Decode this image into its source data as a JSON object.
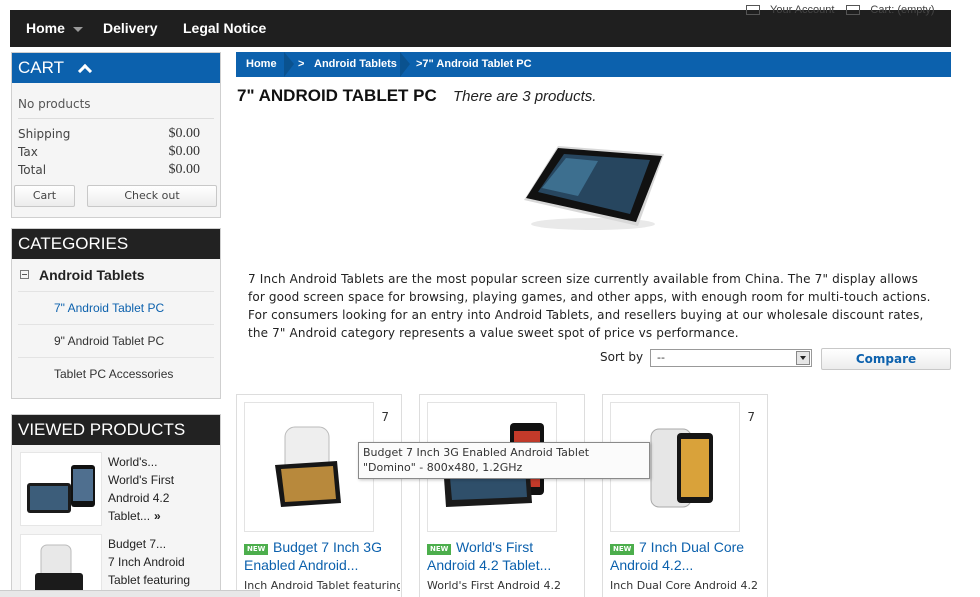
{
  "colors": {
    "accent": "#0c61ad",
    "dark": "#222222",
    "new_badge": "#4cae4c"
  },
  "topnav": {
    "items": [
      {
        "label": "Home",
        "has_dropdown": true
      },
      {
        "label": "Delivery"
      },
      {
        "label": "Legal Notice"
      }
    ],
    "account_label": "Your Account",
    "cart_label": "Cart: (empty)"
  },
  "cart": {
    "title": "CART",
    "empty_text": "No products",
    "rows": [
      {
        "label": "Shipping",
        "value": "$0.00"
      },
      {
        "label": "Tax",
        "value": "$0.00"
      },
      {
        "label": "Total",
        "value": "$0.00"
      }
    ],
    "cart_button": "Cart",
    "checkout_button": "Check out"
  },
  "categories": {
    "title": "CATEGORIES",
    "parent": "Android Tablets",
    "children": [
      {
        "label": "7\" Android Tablet PC",
        "active": true
      },
      {
        "label": "9\" Android Tablet PC"
      },
      {
        "label": "Tablet PC Accessories"
      }
    ]
  },
  "viewed": {
    "title": "VIEWED PRODUCTS",
    "items": [
      {
        "title": "World's...",
        "text": "World's First Android 4.2 Tablet...",
        "more": "»"
      },
      {
        "title": "Budget 7...",
        "text": "7 Inch Android Tablet featuring"
      }
    ]
  },
  "breadcrumb": {
    "home": "Home",
    "sep1": ">",
    "level1": "Android Tablets",
    "level2": ">7\" Android Tablet PC"
  },
  "category_heading": "7\" ANDROID TABLET PC",
  "product_count": "There are 3 products.",
  "description": "7 Inch Android Tablets are the most popular screen size currently available from China. The 7\" display allows for good screen space for browsing, playing games, and other apps, with enough room for multi-touch actions. For consumers looking for an entry into Android Tablets, and resellers buying at our wholesale discount rates, the 7\" Android category represents a value sweet spot of price vs performance.",
  "sort": {
    "label": "Sort by",
    "selected": "--"
  },
  "compare_button": "Compare",
  "products": [
    {
      "badge": "NEW",
      "corner": "7",
      "title": "Budget 7 Inch 3G Enabled Android...",
      "subtitle": "Inch Android Tablet featuring"
    },
    {
      "badge": "NEW",
      "corner": "",
      "title": "World's First Android 4.2 Tablet...",
      "subtitle": "World's First Android 4.2"
    },
    {
      "badge": "NEW",
      "corner": "7",
      "title": "7 Inch Dual Core Android 4.2...",
      "subtitle": "Inch Dual Core Android 4.2"
    }
  ],
  "tooltip": "Budget 7 Inch 3G Enabled Android Tablet \"Domino\" - 800x480, 1.2GHz"
}
